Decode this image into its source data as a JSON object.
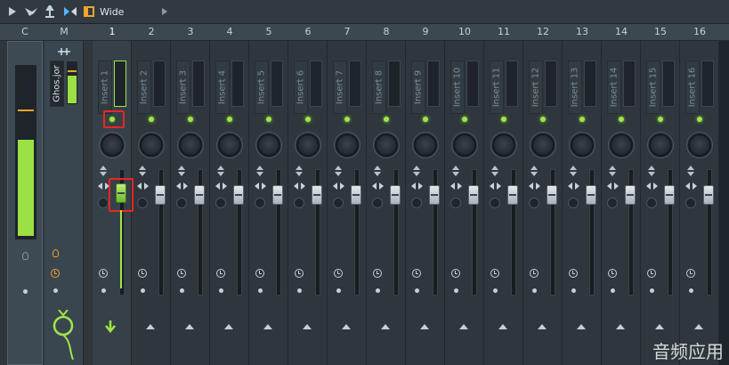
{
  "toolbar": {
    "mode_label": "Wide",
    "icons": [
      "play-triangle-icon",
      "bird-icon",
      "pin-icon",
      "link-icon",
      "layout-icon",
      "arrow-right-icon"
    ]
  },
  "channels": {
    "headers": [
      "C",
      "M",
      "1",
      "2",
      "3",
      "4",
      "5",
      "6",
      "7",
      "8",
      "9",
      "10",
      "11",
      "12",
      "13",
      "14",
      "15",
      "16"
    ],
    "master_name": "Ghos.jor",
    "inserts": [
      "Insert 1",
      "Insert 2",
      "Insert 3",
      "Insert 4",
      "Insert 5",
      "Insert 6",
      "Insert 7",
      "Insert 8",
      "Insert 9",
      "Insert 10",
      "Insert 11",
      "Insert 12",
      "Insert 13",
      "Insert 14",
      "Insert 15",
      "Insert 16"
    ],
    "selected_insert": "1"
  },
  "watermark": "音频应用",
  "colors": {
    "accent_green": "#9ee64a",
    "highlight_red": "#ef2525",
    "orange": "#f1a32b"
  }
}
